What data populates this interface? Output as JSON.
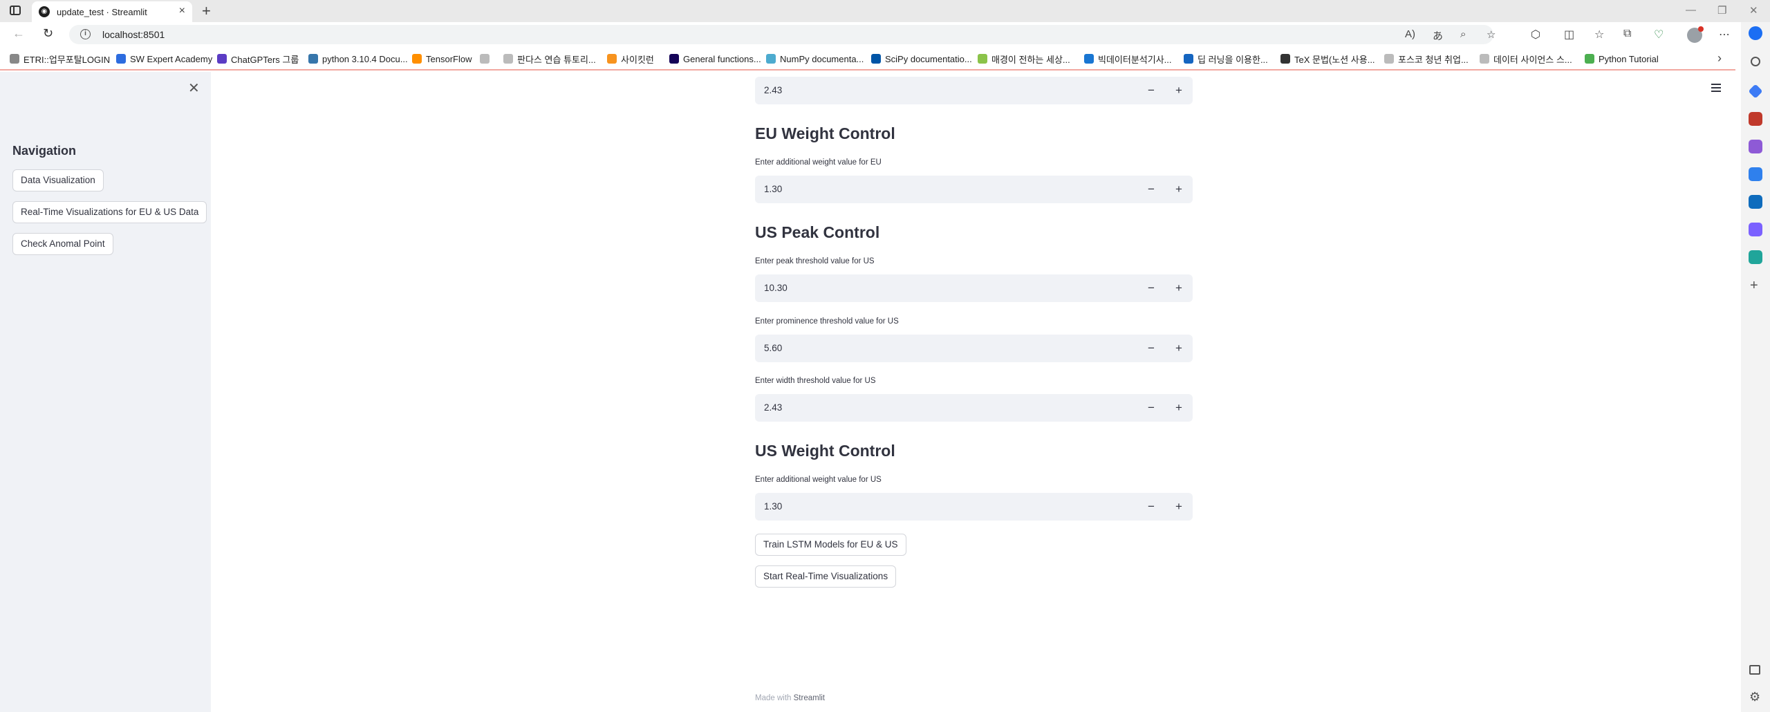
{
  "browser": {
    "tab_title": "update_test · Streamlit",
    "url": "localhost:8501",
    "bookmarks": [
      {
        "label": "ETRI::업무포탈LOGIN",
        "color": "#888888"
      },
      {
        "label": "SW Expert Academy",
        "color": "#2d6cdf"
      },
      {
        "label": "ChatGPTers 그룹",
        "color": "#5b3cc4"
      },
      {
        "label": "python 3.10.4 Docu...",
        "color": "#3776ab"
      },
      {
        "label": "TensorFlow",
        "color": "#ff8f00"
      },
      {
        "label": "",
        "color": "#bbbbbb"
      },
      {
        "label": "판다스 연습 튜토리...",
        "color": "#bbbbbb"
      },
      {
        "label": "사이킷런",
        "color": "#f7931e"
      },
      {
        "label": "General functions...",
        "color": "#150458"
      },
      {
        "label": "NumPy documenta...",
        "color": "#4dabcf"
      },
      {
        "label": "SciPy documentatio...",
        "color": "#0054a6"
      },
      {
        "label": "매경이 전하는 세상...",
        "color": "#8bc34a"
      },
      {
        "label": "빅데이터분석기사...",
        "color": "#1976d2"
      },
      {
        "label": "딥 러닝을 이용한...",
        "color": "#1565c0"
      },
      {
        "label": "TeX 문법(노션 사용...",
        "color": "#333333"
      },
      {
        "label": "포스코 청년 취업...",
        "color": "#bbbbbb"
      },
      {
        "label": "데이터 사이언스 스...",
        "color": "#bbbbbb"
      },
      {
        "label": "Python Tutorial",
        "color": "#4caf50"
      }
    ]
  },
  "sidebar": {
    "title": "Navigation",
    "buttons": [
      "Data Visualization",
      "Real-Time Visualizations for EU & US Data",
      "Check Anomal Point"
    ]
  },
  "main": {
    "top_input_value": "2.43",
    "eu_weight": {
      "title": "EU Weight Control",
      "label": "Enter additional weight value for EU",
      "value": "1.30"
    },
    "us_peak": {
      "title": "US Peak Control",
      "peak_label": "Enter peak threshold value for US",
      "peak_value": "10.30",
      "prominence_label": "Enter prominence threshold value for US",
      "prominence_value": "5.60",
      "width_label": "Enter width threshold value for US",
      "width_value": "2.43"
    },
    "us_weight": {
      "title": "US Weight Control",
      "label": "Enter additional weight value for US",
      "value": "1.30"
    },
    "stepper": {
      "minus": "−",
      "plus": "+"
    },
    "train_button": "Train LSTM Models for EU & US",
    "start_button": "Start Real-Time Visualizations"
  },
  "footer": {
    "prefix": "Made with",
    "link": "Streamlit"
  }
}
